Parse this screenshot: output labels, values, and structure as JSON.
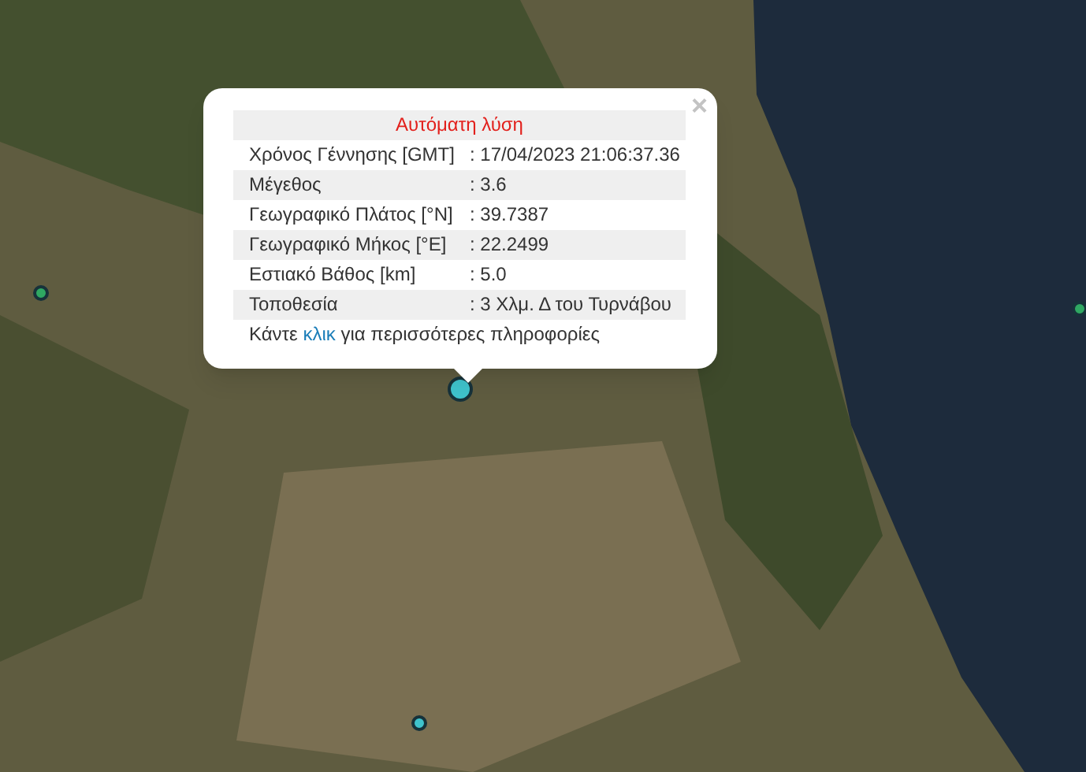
{
  "popup": {
    "title": "Αυτόματη λύση",
    "close": "×",
    "rows": [
      {
        "label": "Χρόνος Γέννησης [GMT]",
        "value": ": 17/04/2023 21:06:37.36"
      },
      {
        "label": "Μέγεθος",
        "value": ": 3.6"
      },
      {
        "label": "Γεωγραφικό Πλάτος [°N]",
        "value": ": 39.7387"
      },
      {
        "label": "Γεωγραφικό Μήκος [°E]",
        "value": ": 22.2499"
      },
      {
        "label": "Εστιακό Βάθος [km]",
        "value": ": 5.0"
      },
      {
        "label": "Τοποθεσία",
        "value": ": 3 Χλμ. Δ του Τυρνάβου"
      }
    ],
    "footer": {
      "before": "Κάντε",
      "link": "κλικ",
      "after": "για περισσότερες πληροφορίες"
    }
  },
  "markers": [
    {
      "color": "#2fa862",
      "selected": false
    },
    {
      "color": "#3fc3cc",
      "selected": true
    },
    {
      "color": "#2fa862",
      "selected": false
    },
    {
      "color": "#3fc3cc",
      "selected": false
    }
  ]
}
